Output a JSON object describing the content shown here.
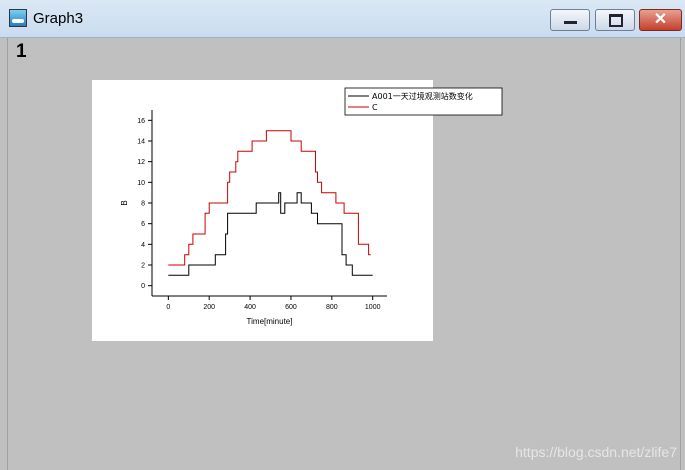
{
  "window": {
    "title": "Graph3",
    "buttons": {
      "minimize": "minimize-icon",
      "maximize": "maximize-icon",
      "close": "✕"
    }
  },
  "layer_label": "1",
  "watermark": "https://blog.csdn.net/zlife7",
  "chart_data": {
    "type": "line",
    "xlabel": "Time[minute]",
    "ylabel": "B",
    "xlim": [
      -80,
      1070
    ],
    "ylim": [
      -1,
      17
    ],
    "xticks": [
      0,
      200,
      400,
      600,
      800,
      1000
    ],
    "yticks": [
      0,
      2,
      4,
      6,
      8,
      10,
      12,
      14,
      16
    ],
    "legend_position": "top-right",
    "series": [
      {
        "name": "A001一天过境观测站数变化",
        "color": "#000000",
        "step": true,
        "points": [
          [
            0,
            1
          ],
          [
            100,
            1
          ],
          [
            100,
            2
          ],
          [
            230,
            2
          ],
          [
            230,
            3
          ],
          [
            280,
            3
          ],
          [
            280,
            5
          ],
          [
            290,
            5
          ],
          [
            290,
            7
          ],
          [
            430,
            7
          ],
          [
            430,
            8
          ],
          [
            540,
            8
          ],
          [
            540,
            9
          ],
          [
            550,
            9
          ],
          [
            550,
            7
          ],
          [
            570,
            7
          ],
          [
            570,
            8
          ],
          [
            630,
            8
          ],
          [
            630,
            9
          ],
          [
            650,
            9
          ],
          [
            650,
            8
          ],
          [
            700,
            8
          ],
          [
            700,
            7
          ],
          [
            730,
            7
          ],
          [
            730,
            6
          ],
          [
            850,
            6
          ],
          [
            850,
            3
          ],
          [
            870,
            3
          ],
          [
            870,
            2
          ],
          [
            900,
            2
          ],
          [
            900,
            1
          ],
          [
            960,
            1
          ],
          [
            960,
            1
          ],
          [
            1000,
            1
          ]
        ]
      },
      {
        "name": "C",
        "color": "#cc0000",
        "step": true,
        "points": [
          [
            0,
            2
          ],
          [
            80,
            2
          ],
          [
            80,
            3
          ],
          [
            100,
            3
          ],
          [
            100,
            4
          ],
          [
            120,
            4
          ],
          [
            120,
            5
          ],
          [
            180,
            5
          ],
          [
            180,
            7
          ],
          [
            200,
            7
          ],
          [
            200,
            8
          ],
          [
            290,
            8
          ],
          [
            290,
            10
          ],
          [
            300,
            10
          ],
          [
            300,
            11
          ],
          [
            330,
            11
          ],
          [
            330,
            12
          ],
          [
            340,
            12
          ],
          [
            340,
            13
          ],
          [
            410,
            13
          ],
          [
            410,
            14
          ],
          [
            480,
            14
          ],
          [
            480,
            15
          ],
          [
            600,
            15
          ],
          [
            600,
            14
          ],
          [
            650,
            14
          ],
          [
            650,
            13
          ],
          [
            720,
            13
          ],
          [
            720,
            11
          ],
          [
            730,
            11
          ],
          [
            730,
            10
          ],
          [
            750,
            10
          ],
          [
            750,
            9
          ],
          [
            820,
            9
          ],
          [
            820,
            8
          ],
          [
            860,
            8
          ],
          [
            860,
            7
          ],
          [
            930,
            7
          ],
          [
            930,
            4
          ],
          [
            980,
            4
          ],
          [
            980,
            3
          ],
          [
            990,
            3
          ]
        ]
      }
    ]
  }
}
